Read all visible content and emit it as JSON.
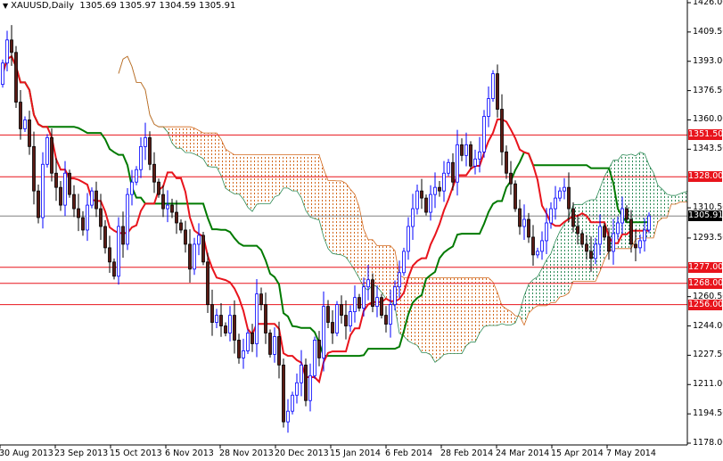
{
  "header": {
    "symbol": "XAUUSD,Daily",
    "ohlc": "1305.69 1305.97 1304.59 1305.91"
  },
  "chart_data": {
    "type": "candlestick",
    "title": "XAUUSD,Daily",
    "indicator": "Ichimoku Kinko Hyo",
    "ylim": [
      1178,
      1426
    ],
    "y_ticks": [
      "1426.00",
      "1409.50",
      "1393.00",
      "1376.50",
      "1360.00",
      "1343.50",
      "1310.50",
      "1293.50",
      "1260.50",
      "1244.00",
      "1227.50",
      "1211.00",
      "1194.50",
      "1178.00"
    ],
    "y_tick_values": [
      1426,
      1409.5,
      1393,
      1376.5,
      1360,
      1343.5,
      1310.5,
      1293.5,
      1260.5,
      1244,
      1227.5,
      1211,
      1194.5,
      1178
    ],
    "x_ticks": [
      "30 Aug 2013",
      "23 Sep 2013",
      "15 Oct 2013",
      "6 Nov 2013",
      "28 Nov 2013",
      "20 Dec 2013",
      "15 Jan 2014",
      "6 Feb 2014",
      "28 Feb 2014",
      "24 Mar 2014",
      "15 Apr 2014",
      "7 May 2014"
    ],
    "levels": [
      {
        "label": "1351.50",
        "value": 1351.5
      },
      {
        "label": "1328.00",
        "value": 1328
      },
      {
        "label": "1277.00",
        "value": 1277
      },
      {
        "label": "1268.00",
        "value": 1268
      },
      {
        "label": "1256.00",
        "value": 1256
      }
    ],
    "current": {
      "label": "1305.91",
      "value": 1305.91
    },
    "first_open": 1380,
    "closes": [
      1392,
      1405,
      1398,
      1370,
      1355,
      1360,
      1345,
      1320,
      1305,
      1335,
      1350,
      1330,
      1322,
      1312,
      1330,
      1318,
      1310,
      1305,
      1298,
      1312,
      1320,
      1310,
      1300,
      1288,
      1280,
      1272,
      1300,
      1290,
      1318,
      1325,
      1332,
      1345,
      1350,
      1335,
      1325,
      1318,
      1310,
      1312,
      1308,
      1302,
      1298,
      1290,
      1276,
      1290,
      1295,
      1280,
      1256,
      1246,
      1250,
      1244,
      1240,
      1250,
      1236,
      1226,
      1230,
      1240,
      1234,
      1262,
      1256,
      1240,
      1228,
      1238,
      1222,
      1190,
      1196,
      1205,
      1212,
      1222,
      1202,
      1216,
      1236,
      1226,
      1255,
      1246,
      1240,
      1256,
      1250,
      1244,
      1252,
      1260,
      1254,
      1266,
      1270,
      1255,
      1260,
      1250,
      1245,
      1256,
      1266,
      1274,
      1286,
      1300,
      1310,
      1320,
      1316,
      1308,
      1318,
      1322,
      1320,
      1330,
      1336,
      1325,
      1346,
      1340,
      1346,
      1334,
      1338,
      1342,
      1362,
      1372,
      1386,
      1366,
      1342,
      1330,
      1324,
      1310,
      1300,
      1304,
      1294,
      1284,
      1286,
      1292,
      1302,
      1310,
      1316,
      1320,
      1322,
      1310,
      1300,
      1296,
      1290,
      1286,
      1282,
      1290,
      1300,
      1294,
      1286,
      1296,
      1302,
      1310,
      1304,
      1290,
      1288,
      1292,
      1298,
      1305.91
    ],
    "colors": {
      "bull": "#0000ff",
      "bear": "#5a1a14",
      "tenkan": "#e8141c",
      "kijun": "#007a00",
      "level": "#e8141c",
      "current_line": "#808080"
    }
  }
}
